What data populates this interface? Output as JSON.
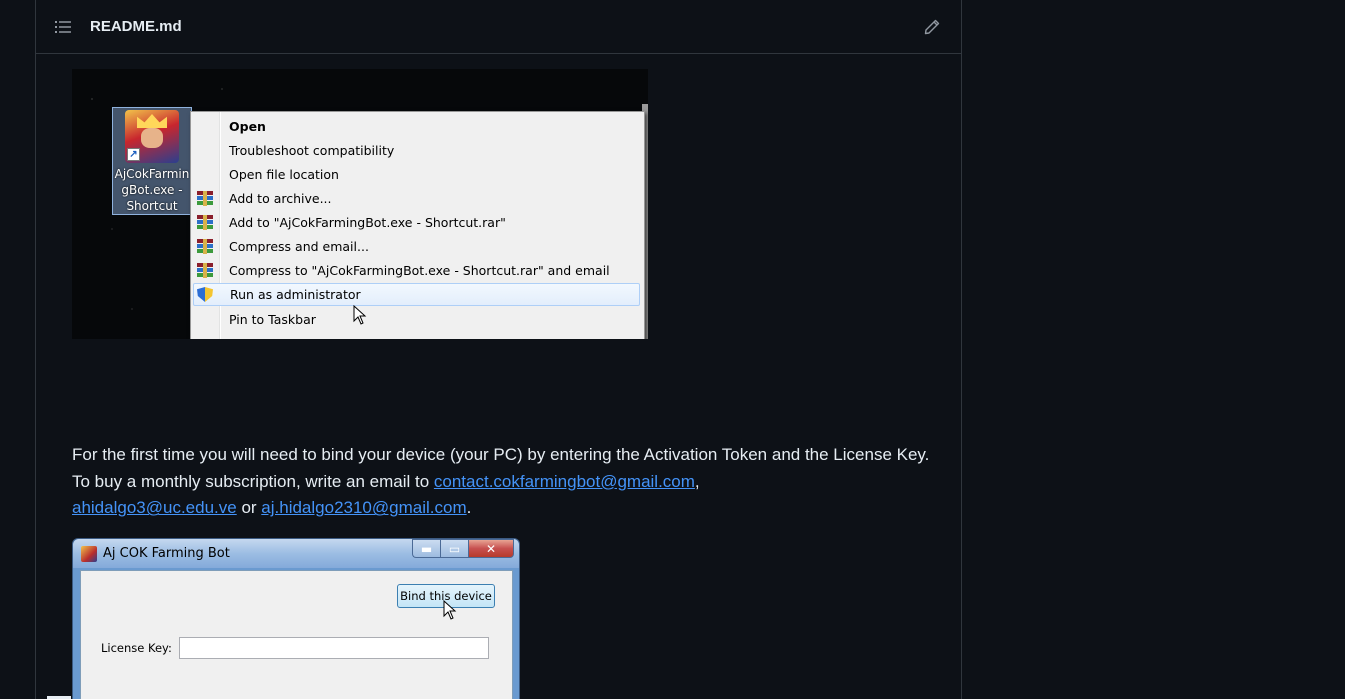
{
  "readme": {
    "title": "README.md",
    "toc_icon": "list-unordered-icon",
    "edit_icon": "pencil-icon"
  },
  "screenshot_context_menu": {
    "desktop_icon_label": "AjCokFarmin\ngBot.exe -\nShortcut",
    "menu_items": [
      {
        "label": "Open",
        "icon": "",
        "bold": true
      },
      {
        "label": "Troubleshoot compatibility",
        "icon": ""
      },
      {
        "label": "Open file location",
        "icon": ""
      },
      {
        "label": "Add to archive...",
        "icon": "winrar-icon"
      },
      {
        "label": "Add to \"AjCokFarmingBot.exe - Shortcut.rar\"",
        "icon": "winrar-icon"
      },
      {
        "label": "Compress and email...",
        "icon": "winrar-icon"
      },
      {
        "label": "Compress to \"AjCokFarmingBot.exe - Shortcut.rar\" and email",
        "icon": "winrar-icon"
      },
      {
        "label": "Run as administrator",
        "icon": "uac-shield-icon",
        "highlighted": true
      },
      {
        "label": "Pin to Taskbar",
        "icon": ""
      }
    ]
  },
  "paragraph": {
    "text_1": "For the first time you will need to bind your device (your PC) by entering the Activation Token and the License Key. To buy a monthly subscription, write an email to ",
    "link_1": "contact.cokfarmingbot@gmail.com",
    "text_2": ", ",
    "link_2": "ahidalgo3@uc.edu.ve",
    "text_3": " or ",
    "link_3": "aj.hidalgo2310@gmail.com",
    "text_4": "."
  },
  "screenshot_app_window": {
    "window_title": "Aj COK Farming Bot",
    "minimize_glyph": "▬",
    "maximize_glyph": "▭",
    "close_glyph": "✕",
    "bind_button_label": "Bind this device",
    "license_label": "License Key:",
    "license_value": ""
  },
  "colors": {
    "background": "#0d1117",
    "border": "#30363d",
    "link": "#4493f8",
    "text": "#e6edf3"
  }
}
